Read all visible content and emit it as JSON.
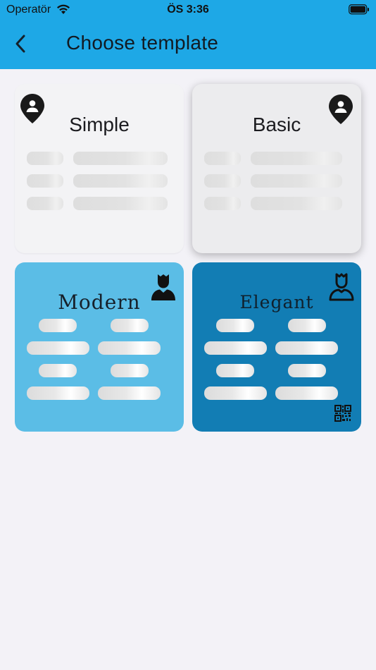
{
  "status_bar": {
    "carrier": "Operatör",
    "time": "ÖS 3:36"
  },
  "header": {
    "title": "Choose template",
    "back_icon": "chevron-left-icon"
  },
  "colors": {
    "header": "#1ea8e6",
    "modern": "#5bbde6",
    "elegant": "#127db4",
    "background": "#f3f2f7"
  },
  "templates": [
    {
      "name": "Simple",
      "icon": "location-person-icon"
    },
    {
      "name": "Basic",
      "icon": "location-person-icon"
    },
    {
      "name": "Modern",
      "icon": "person-icon"
    },
    {
      "name": "Elegant",
      "icon": "person-outline-icon",
      "extra_icon": "qr-code-icon"
    }
  ]
}
